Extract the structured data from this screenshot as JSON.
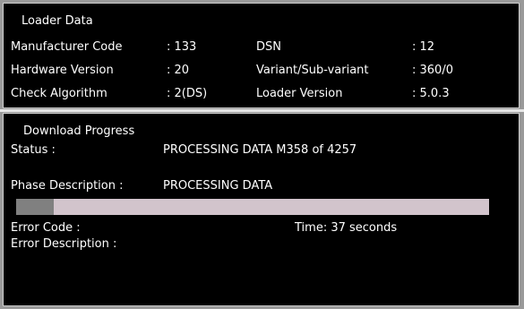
{
  "loader": {
    "title": "Loader Data",
    "manufacturer_code_label": "Manufacturer Code",
    "manufacturer_code_value": ": 133",
    "dsn_label": "DSN",
    "dsn_value": ": 12",
    "hardware_version_label": "Hardware Version",
    "hardware_version_value": ": 20",
    "variant_label": "Variant/Sub-variant",
    "variant_value": ": 360/0",
    "check_algorithm_label": "Check Algorithm",
    "check_algorithm_value": ": 2(DS)",
    "loader_version_label": "Loader Version",
    "loader_version_value": ": 5.0.3"
  },
  "download": {
    "title": "Download Progress",
    "status_label": "Status :",
    "status_value": "PROCESSING DATA M358 of 4257",
    "phase_label": "Phase Description :",
    "phase_value": "PROCESSING DATA",
    "progress_fraction": 0.08,
    "error_code_label": "Error Code :",
    "time_text": "Time: 37 seconds",
    "error_description_label": "Error Description :"
  },
  "colors": {
    "background": "#000000",
    "text": "#ffffff",
    "progress_track": "#d2c4cc",
    "progress_fill": "#808080"
  }
}
